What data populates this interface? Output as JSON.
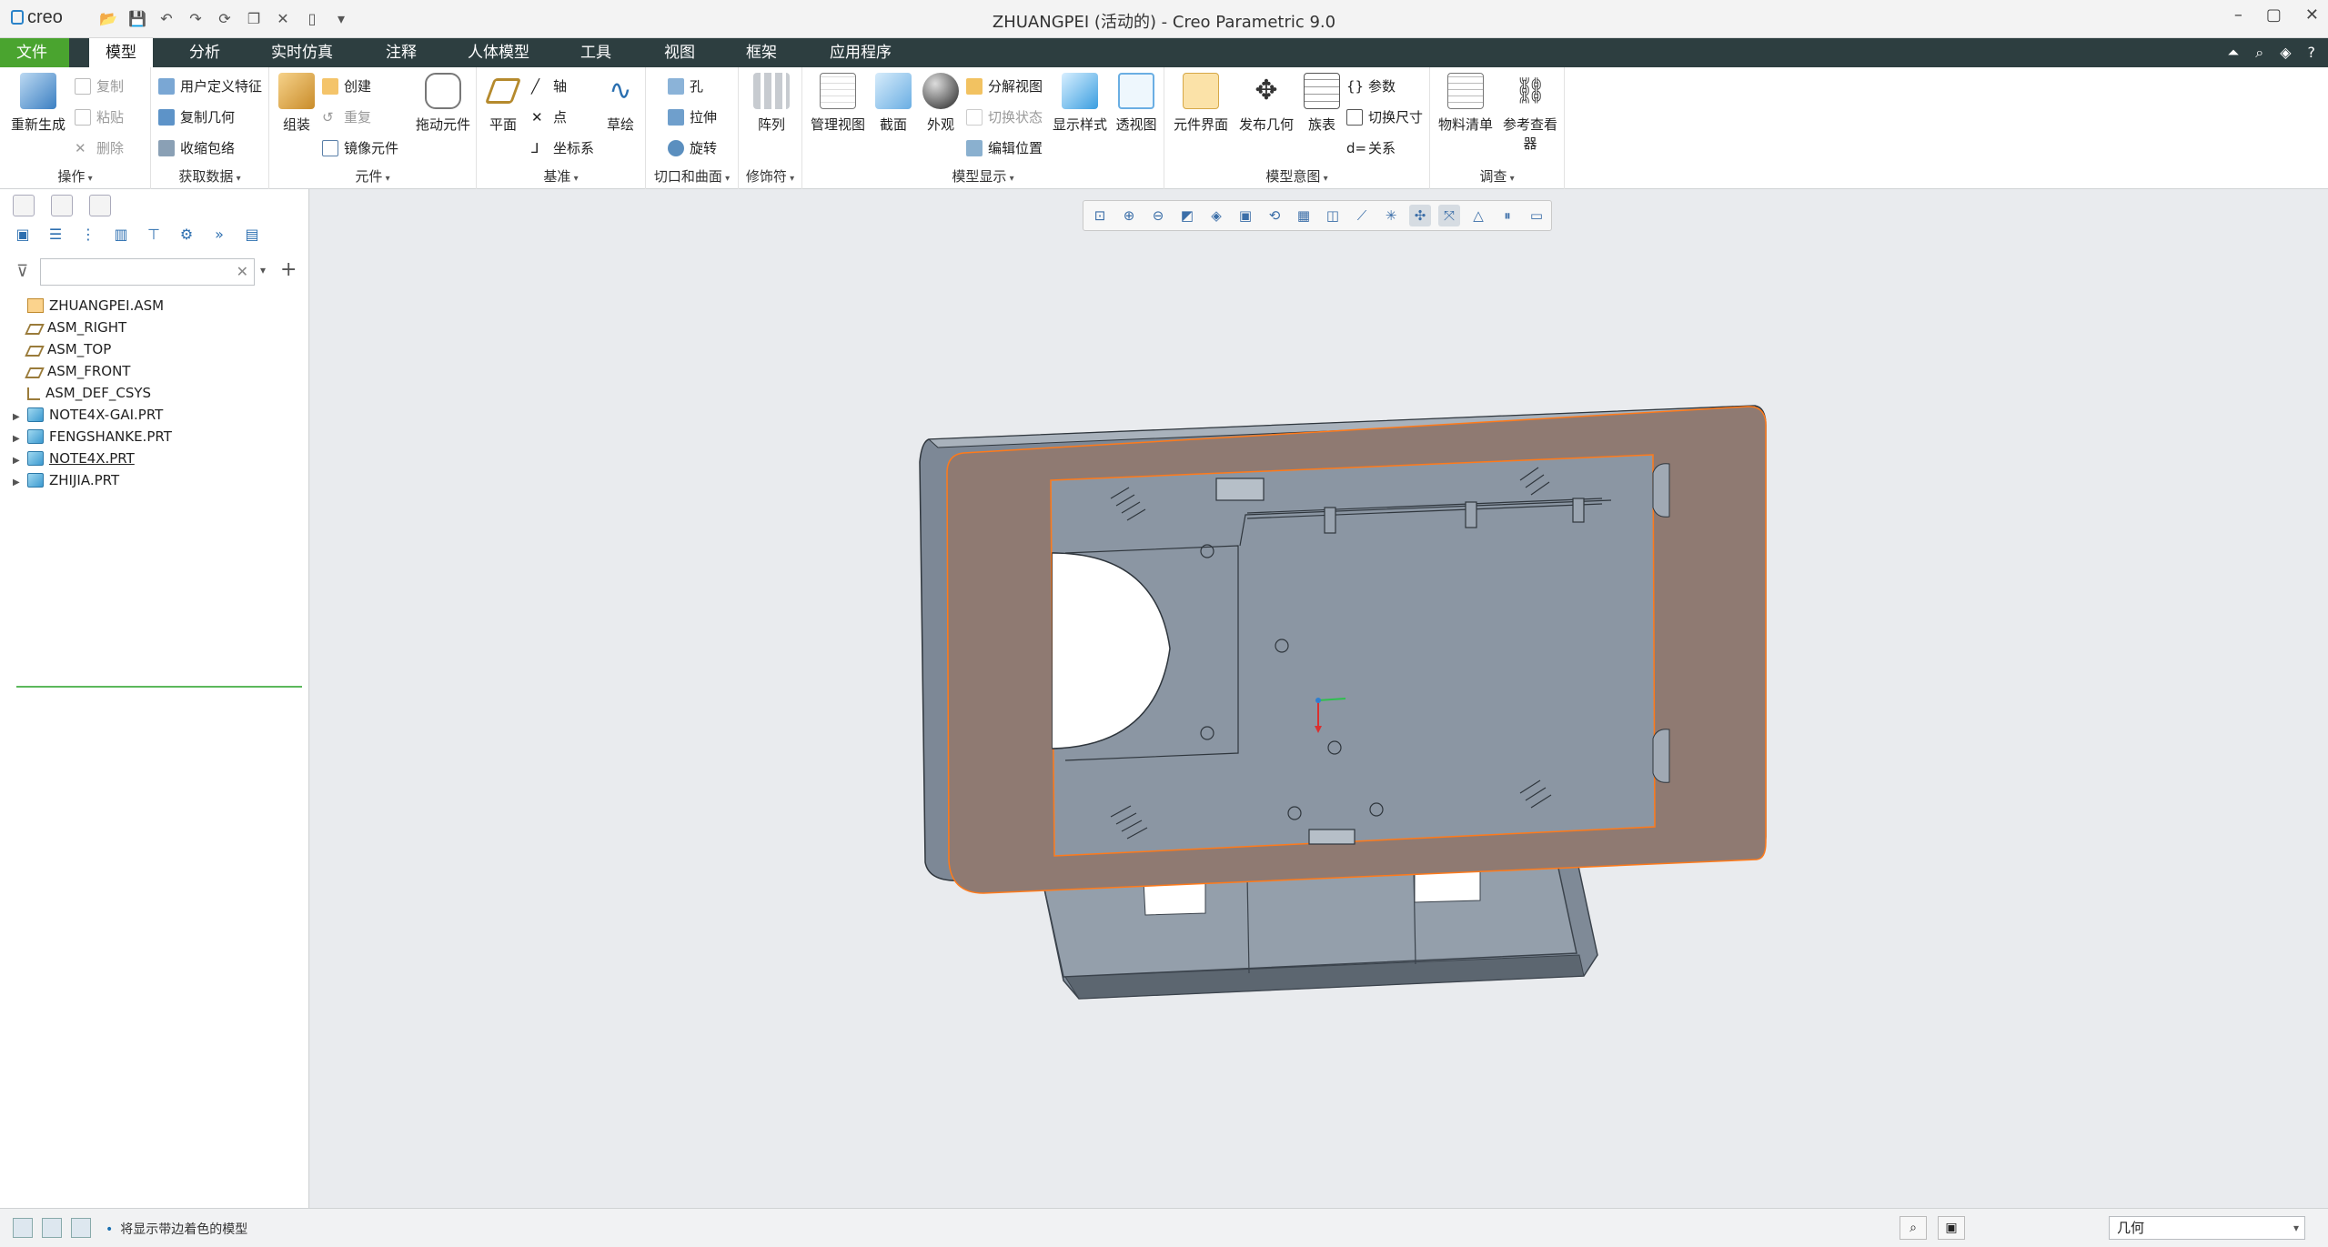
{
  "window": {
    "title": "ZHUANGPEI (活动的) - Creo Parametric 9.0",
    "logo": "creo"
  },
  "menu_tabs": [
    {
      "label": "文件"
    },
    {
      "label": "模型"
    },
    {
      "label": "分析"
    },
    {
      "label": "实时仿真"
    },
    {
      "label": "注释"
    },
    {
      "label": "人体模型"
    },
    {
      "label": "工具"
    },
    {
      "label": "视图"
    },
    {
      "label": "框架"
    },
    {
      "label": "应用程序"
    }
  ],
  "ribbon": {
    "operations": {
      "title": "操作",
      "regenerate": "重新生成",
      "copy": "复制",
      "paste": "粘贴",
      "delete": "删除"
    },
    "get_data": {
      "title": "获取数据",
      "udf": "用户定义特征",
      "copy_geom": "复制几何",
      "shrinkwrap": "收缩包络"
    },
    "component": {
      "title": "元件",
      "assemble": "组装",
      "create": "创建",
      "repeat": "重复",
      "mirror": "镜像元件",
      "drag": "拖动元件"
    },
    "datum": {
      "title": "基准",
      "plane": "平面",
      "axis": "轴",
      "point": "点",
      "csys": "坐标系",
      "sketch": "草绘"
    },
    "cut_surface": {
      "title": "切口和曲面",
      "hole": "孔",
      "extrude": "拉伸",
      "revolve": "旋转"
    },
    "modifiers": {
      "title": "修饰符",
      "pattern": "阵列"
    },
    "model_display": {
      "title": "模型显示",
      "manage_views": "管理视图",
      "section": "截面",
      "appearance": "外观",
      "explode": "分解视图",
      "toggle_status": "切换状态",
      "edit_position": "编辑位置",
      "display_style": "显示样式",
      "perspective": "透视图"
    },
    "model_intent": {
      "title": "模型意图",
      "component_interface": "元件界面",
      "publish_geom": "发布几何",
      "family_table": "族表",
      "params": "参数",
      "switch_dims": "切换尺寸",
      "relations": "关系"
    },
    "investigate": {
      "title": "调查",
      "bom": "物料清单",
      "ref_viewer": "参考查看器"
    }
  },
  "model_tree": {
    "items": [
      {
        "label": "ZHUANGPEI.ASM",
        "type": "asm"
      },
      {
        "label": "ASM_RIGHT",
        "type": "plane"
      },
      {
        "label": "ASM_TOP",
        "type": "plane"
      },
      {
        "label": "ASM_FRONT",
        "type": "plane"
      },
      {
        "label": "ASM_DEF_CSYS",
        "type": "csys"
      },
      {
        "label": "NOTE4X-GAI.PRT",
        "type": "prt"
      },
      {
        "label": "FENGSHANKE.PRT",
        "type": "prt"
      },
      {
        "label": "NOTE4X.PRT",
        "type": "prt"
      },
      {
        "label": "ZHIJIA.PRT",
        "type": "prt"
      }
    ]
  },
  "status": {
    "message": "将显示带边着色的模型",
    "filter_value": "几何"
  },
  "colors": {
    "tabbar": "#2d3e40",
    "file_tab": "#4aa42f",
    "frame": "#8f7a72",
    "body": "#8b96a3"
  }
}
